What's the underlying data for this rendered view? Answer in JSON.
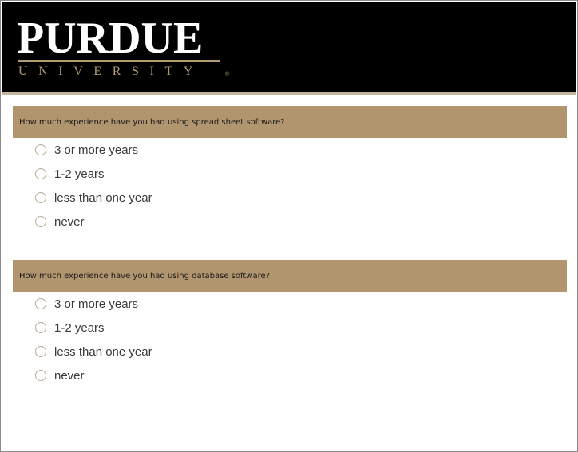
{
  "header": {
    "logo_word": "PURDUE",
    "logo_sub": "UNIVERSITY",
    "logo_reg": "®"
  },
  "questions": [
    {
      "prompt": "How much experience have you had using spread sheet software?",
      "options": [
        "3 or more years",
        "1-2 years",
        "less than one year",
        "never"
      ]
    },
    {
      "prompt": "How much experience have you had using database software?",
      "options": [
        "3 or more years",
        "1-2 years",
        "less than one year",
        "never"
      ]
    }
  ],
  "colors": {
    "header_bg": "#000000",
    "brand_gold": "#b1956e",
    "logo_gold": "#b19b72",
    "radio_border": "#b9ab93"
  }
}
